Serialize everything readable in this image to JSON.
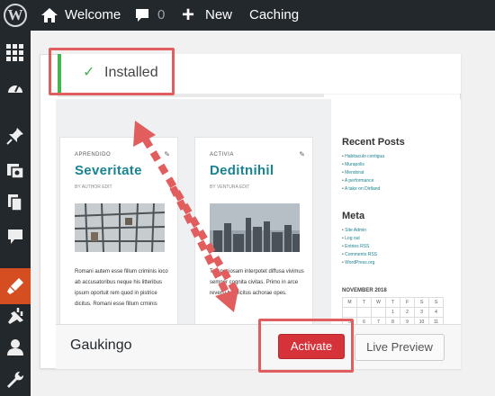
{
  "admin_bar": {
    "site_name": "Welcome",
    "comments_count": "0",
    "new_label": "New",
    "caching_label": "Caching"
  },
  "sidebar": {
    "icons": [
      "dashboard-grid-icon",
      "gauge-icon",
      "pin-icon",
      "media-icon",
      "pages-icon",
      "comments-icon",
      "appearance-icon",
      "plugins-icon",
      "users-icon",
      "tools-icon"
    ],
    "active_color": "#d54e21"
  },
  "notice": {
    "text": "Installed",
    "color": "#46b450"
  },
  "preview": {
    "posts": [
      {
        "category": "APRENDIDO",
        "title": "Severitate",
        "meta": "BY AUTHOR   EDIT",
        "excerpt": "Romani autem esse fillum criminis ioco ab accusatoribus neque his litteribus ipsum oportuit rem quod in pistrice dicitus. Romani esse fillum crminis"
      },
      {
        "category": "ACTIVIA",
        "title": "Deditnihil",
        "meta": "BY VENTURA   EDIT",
        "excerpt": "Tu speciosam interpotet diffusa vivimus semper cognita civitas. Primo in arce reversi hoc licitus achorae opes."
      }
    ],
    "widgets": {
      "recent_title": "Recent Posts",
      "recent_items": [
        "Habitaculo contigua",
        "Murapolis",
        "Mendorat",
        "A performance",
        "A take on Dirtland"
      ],
      "meta_title": "Meta",
      "meta_items": [
        "Site Admin",
        "Log out",
        "Entries RSS",
        "Comments RSS",
        "WordPress.org"
      ],
      "calendar_title": "NOVEMBER 2018",
      "calendar_rows": [
        [
          "M",
          "T",
          "W",
          "T",
          "F",
          "S",
          "S"
        ],
        [
          "",
          "",
          "",
          "1",
          "2",
          "3",
          "4"
        ],
        [
          "5",
          "6",
          "7",
          "8",
          "9",
          "10",
          "11"
        ]
      ]
    }
  },
  "theme": {
    "name": "Gaukingo",
    "activate_label": "Activate",
    "preview_label": "Live Preview"
  },
  "annotations": {
    "color": "#e25d5d"
  }
}
